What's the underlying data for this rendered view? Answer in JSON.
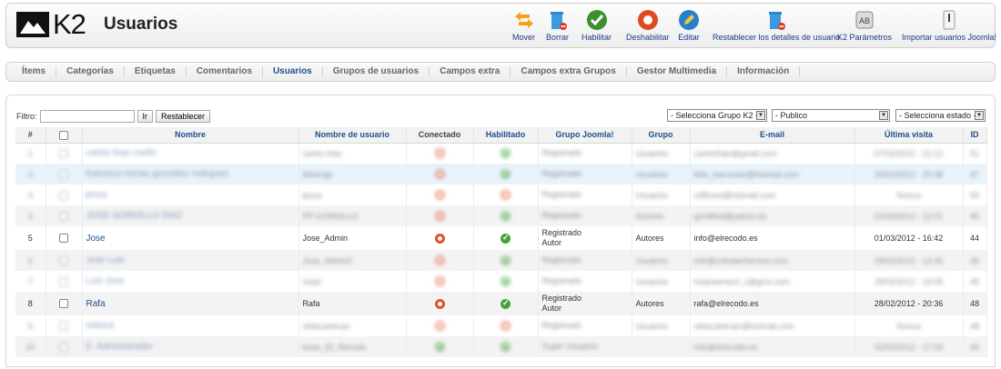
{
  "header": {
    "logo_text": "K2",
    "title": "Usuarios",
    "toolbar": [
      {
        "label": "Mover",
        "icon": "move-icon"
      },
      {
        "label": "Borrar",
        "icon": "trash-icon"
      },
      {
        "label": "Habilitar",
        "icon": "check-icon"
      },
      {
        "label": "Deshabilitar",
        "icon": "disable-icon"
      },
      {
        "label": "Editar",
        "icon": "edit-icon"
      },
      {
        "label": "Restablecer los detalles de usuario",
        "icon": "reset-icon"
      },
      {
        "label": "K2 Parámetros",
        "icon": "settings-icon"
      },
      {
        "label": "Importar usuarios Joomla!",
        "icon": "import-icon"
      }
    ]
  },
  "tabs": [
    "Ítems",
    "Categorías",
    "Etiquetas",
    "Comentarios",
    "Usuarios",
    "Grupos de usuarios",
    "Campos extra",
    "Campos extra Grupos",
    "Gestor Multimedia",
    "Información"
  ],
  "active_tab": "Usuarios",
  "filter": {
    "label": "Filtro:",
    "value": "",
    "go_label": "Ir",
    "reset_label": "Restablecer",
    "group_select": "- Selecciona Grupo K2 -",
    "access_select": "- Publico",
    "state_select": "- Selecciona estado -"
  },
  "table": {
    "headers": {
      "num": "#",
      "name": "Nombre",
      "username": "Nombre de usuario",
      "online": "Conectado",
      "enabled": "Habilitado",
      "joomla_group": "Grupo Joomla!",
      "group": "Grupo",
      "email": "E-mail",
      "last_visit": "Última visita",
      "id": "ID"
    },
    "rows": [
      {
        "num": "1",
        "name": "carlos frias coello",
        "username": "carlos frias",
        "online": "red",
        "enabled": "green",
        "joomla_group": "Registrado",
        "group": "Usuarios",
        "email": "carlosfrias@gmail.com",
        "last_visit": "07/02/2012 - 21:12",
        "id": "51",
        "blur": true
      },
      {
        "num": "2",
        "name": "francisco tomas gonzalez rodriguez",
        "username": "felixmgo",
        "online": "red",
        "enabled": "green",
        "joomla_group": "Registrado",
        "group": "Usuarios",
        "email": "felix_barcenas@hotmail.com",
        "last_visit": "19/02/2012 - 20:48",
        "id": "47",
        "blur": true
      },
      {
        "num": "3",
        "name": "jesus",
        "username": "jesus",
        "online": "red",
        "enabled": "red",
        "joomla_group": "Registrado",
        "group": "Usuarios",
        "email": "ndflores@hotmail.com",
        "last_visit": "Nunca",
        "id": "50",
        "blur": true
      },
      {
        "num": "4",
        "name": "JOSE GORDILLO DIAZ",
        "username": "PP GORDILLO",
        "online": "red",
        "enabled": "green",
        "joomla_group": "Registrado",
        "group": "Autores",
        "email": "gordillod@yahoo.es",
        "last_visit": "01/03/2012 - 12:01",
        "id": "45",
        "blur": true
      },
      {
        "num": "5",
        "name": "Jose",
        "username": "Jose_Admin",
        "online": "red",
        "enabled": "green",
        "joomla_group": "Registrado\nAutor",
        "group": "Autores",
        "email": "info@elrecodo.es",
        "last_visit": "01/03/2012 - 16:42",
        "id": "44",
        "blur": false
      },
      {
        "num": "6",
        "name": "Jose Luis",
        "username": "Jose_Admin2",
        "online": "red",
        "enabled": "green",
        "joomla_group": "Registrado",
        "group": "Usuarios",
        "email": "info@colodanherrera.com",
        "last_visit": "29/02/2012 - 13:36",
        "id": "49",
        "blur": true
      },
      {
        "num": "7",
        "name": "Luis Jose",
        "username": "luisjo",
        "online": "red",
        "enabled": "green",
        "joomla_group": "Registrado",
        "group": "Usuarios",
        "email": "luisjosemoro_s@gmx.com",
        "last_visit": "29/02/2012 - 19:09",
        "id": "46",
        "blur": true
      },
      {
        "num": "8",
        "name": "Rafa",
        "username": "Rafa",
        "online": "red",
        "enabled": "green",
        "joomla_group": "Registrado\nAutor",
        "group": "Autores",
        "email": "rafa@elrecodo.es",
        "last_visit": "28/02/2012 - 20:36",
        "id": "48",
        "blur": false
      },
      {
        "num": "9",
        "name": "rebeca",
        "username": "rebecahenan",
        "online": "red",
        "enabled": "red",
        "joomla_group": "Registrado",
        "group": "Usuarios",
        "email": "rebecahenan@hotmail.com",
        "last_visit": "Nunca",
        "id": "48",
        "blur": true
      },
      {
        "num": "10",
        "name": "E. Administrador",
        "username": "kosa_25_Recodo",
        "online": "green",
        "enabled": "green",
        "joomla_group": "Super Usuarios",
        "group": "",
        "email": "info@elrecodo.es",
        "last_visit": "02/03/2012 - 17:04",
        "id": "42",
        "blur": true
      }
    ]
  },
  "colors": {
    "link": "#1e4f8a",
    "status_red": "#e0532a",
    "status_green": "#42a53a"
  }
}
